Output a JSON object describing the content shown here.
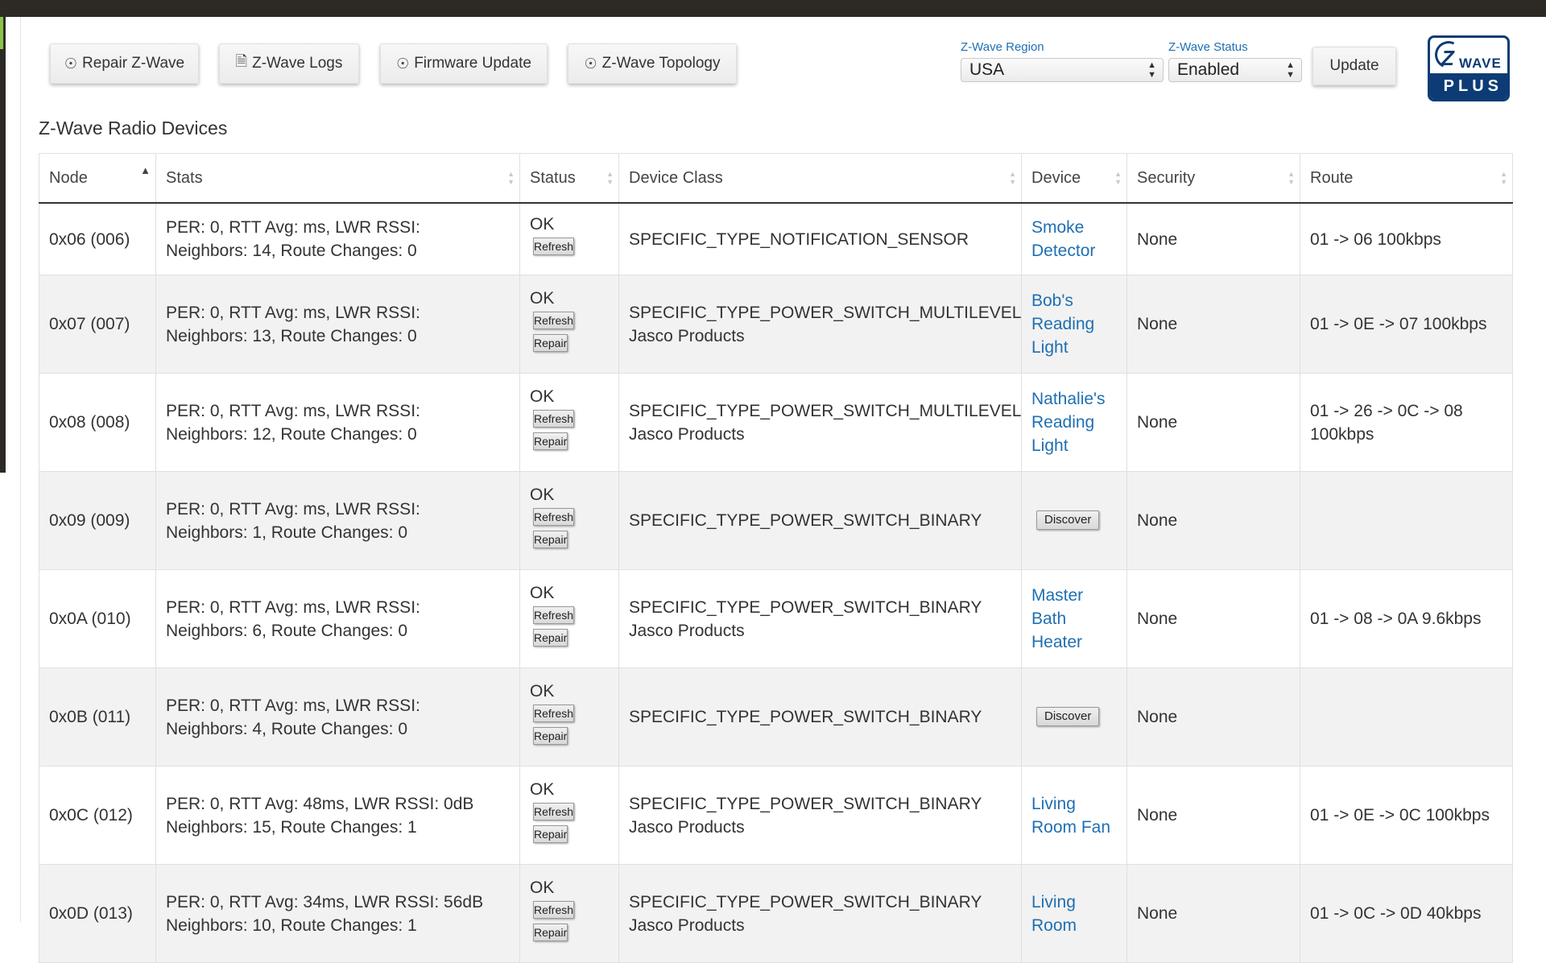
{
  "toolbar": {
    "repair_label": "Repair Z-Wave",
    "logs_label": "Z-Wave Logs",
    "firmware_label": "Firmware Update",
    "topology_label": "Z-Wave Topology"
  },
  "region": {
    "label": "Z-Wave Region",
    "value": "USA"
  },
  "status_select": {
    "label": "Z-Wave Status",
    "value": "Enabled"
  },
  "update_label": "Update",
  "logo": {
    "z": "Z",
    "wave": "WAVE",
    "plus": "PLUS"
  },
  "section_title": "Z-Wave Radio Devices",
  "table": {
    "columns": [
      "Node",
      "Stats",
      "Status",
      "Device Class",
      "Device",
      "Security",
      "Route"
    ],
    "refresh_label": "Refresh",
    "repair_label": "Repair",
    "discover_label": "Discover",
    "rows": [
      {
        "node": "0x06 (006)",
        "stats1": "PER: 0, RTT Avg: ms, LWR RSSI:",
        "stats2": "Neighbors: 14, Route Changes: 0",
        "status": "OK",
        "class1": "SPECIFIC_TYPE_NOTIFICATION_SENSOR",
        "class2": "",
        "device": "Smoke Detector",
        "security": "None",
        "route": "01 -> 06 100kbps"
      },
      {
        "node": "0x07 (007)",
        "stats1": "PER: 0, RTT Avg: ms, LWR RSSI:",
        "stats2": "Neighbors: 13, Route Changes: 0",
        "status": "OK",
        "class1": "SPECIFIC_TYPE_POWER_SWITCH_MULTILEVEL",
        "class2": "Jasco Products",
        "device": "Bob's Reading Light",
        "security": "None",
        "route": "01 -> 0E -> 07 100kbps"
      },
      {
        "node": "0x08 (008)",
        "stats1": "PER: 0, RTT Avg: ms, LWR RSSI:",
        "stats2": "Neighbors: 12, Route Changes: 0",
        "status": "OK",
        "class1": "SPECIFIC_TYPE_POWER_SWITCH_MULTILEVEL",
        "class2": "Jasco Products",
        "device": "Nathalie's Reading Light",
        "security": "None",
        "route": "01 -> 26 -> 0C -> 08 100kbps"
      },
      {
        "node": "0x09 (009)",
        "stats1": "PER: 0, RTT Avg: ms, LWR RSSI:",
        "stats2": "Neighbors: 1, Route Changes: 0",
        "status": "OK",
        "class1": "SPECIFIC_TYPE_POWER_SWITCH_BINARY",
        "class2": "",
        "device": "",
        "security": "None",
        "route": ""
      },
      {
        "node": "0x0A (010)",
        "stats1": "PER: 0, RTT Avg: ms, LWR RSSI:",
        "stats2": "Neighbors: 6, Route Changes: 0",
        "status": "OK",
        "class1": "SPECIFIC_TYPE_POWER_SWITCH_BINARY",
        "class2": "Jasco Products",
        "device": "Master Bath Heater",
        "security": "None",
        "route": "01 -> 08 -> 0A 9.6kbps"
      },
      {
        "node": "0x0B (011)",
        "stats1": "PER: 0, RTT Avg: ms, LWR RSSI:",
        "stats2": "Neighbors: 4, Route Changes: 0",
        "status": "OK",
        "class1": "SPECIFIC_TYPE_POWER_SWITCH_BINARY",
        "class2": "",
        "device": "",
        "security": "None",
        "route": ""
      },
      {
        "node": "0x0C (012)",
        "stats1": "PER: 0, RTT Avg: 48ms, LWR RSSI: 0dB",
        "stats2": "Neighbors: 15, Route Changes: 1",
        "status": "OK",
        "class1": "SPECIFIC_TYPE_POWER_SWITCH_BINARY",
        "class2": "Jasco Products",
        "device": "Living Room Fan",
        "security": "None",
        "route": "01 -> 0E -> 0C 100kbps"
      },
      {
        "node": "0x0D (013)",
        "stats1": "PER: 0, RTT Avg: 34ms, LWR RSSI: 56dB",
        "stats2": "Neighbors: 10, Route Changes: 1",
        "status": "OK",
        "class1": "SPECIFIC_TYPE_POWER_SWITCH_BINARY",
        "class2": "Jasco Products",
        "device": "Living Room",
        "security": "None",
        "route": "01 -> 0C -> 0D 40kbps"
      }
    ]
  }
}
